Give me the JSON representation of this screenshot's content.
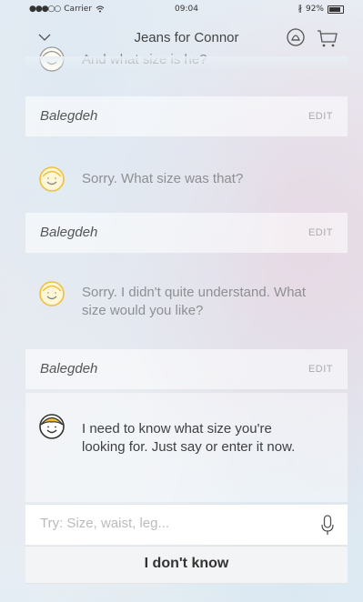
{
  "status_bar": {
    "carrier": "Carrier",
    "time": "09:04",
    "battery": "92%"
  },
  "nav": {
    "title": "Jeans for Connor"
  },
  "conversation": {
    "partial_question": "And what size is he?",
    "answers": [
      {
        "value": "Balegdeh",
        "edit_label": "EDIT"
      },
      {
        "value": "Balegdeh",
        "edit_label": "EDIT"
      },
      {
        "value": "Balegdeh",
        "edit_label": "EDIT"
      }
    ],
    "bot_messages": [
      "Sorry. What size was that?",
      "Sorry. I didn't quite understand. What size would you like?",
      "I need to know what size you're looking for. Just say or enter it now."
    ]
  },
  "input": {
    "placeholder": "Try: Size, waist, leg..."
  },
  "quick_reply": {
    "label": "I don't know"
  }
}
